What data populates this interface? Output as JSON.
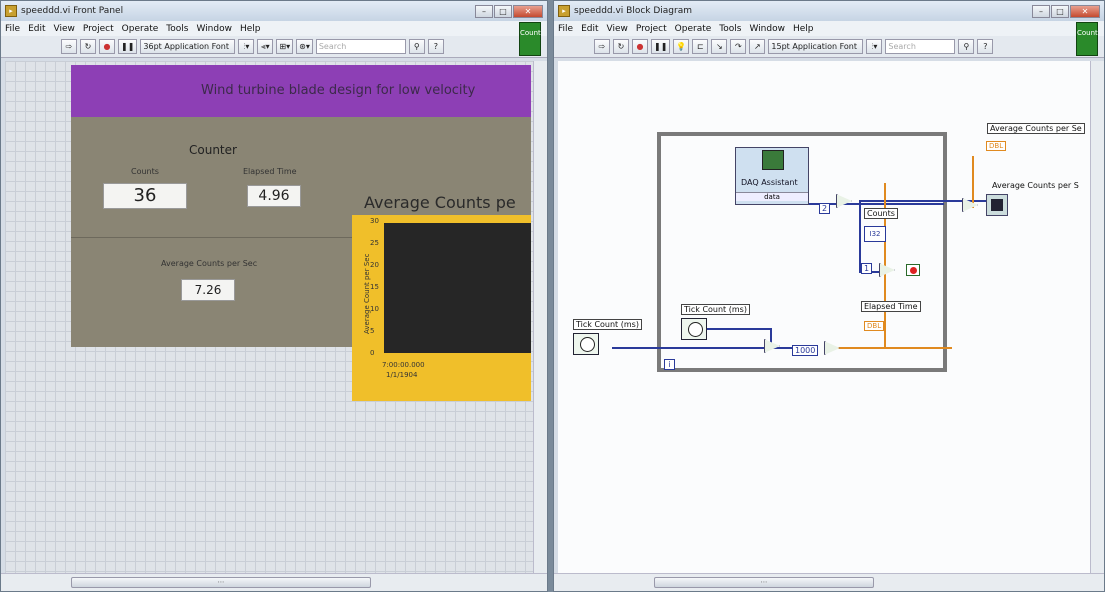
{
  "left_window": {
    "title": "speeddd.vi Front Panel",
    "menu": [
      "File",
      "Edit",
      "View",
      "Project",
      "Operate",
      "Tools",
      "Window",
      "Help"
    ],
    "font_selector": "36pt Application Font",
    "search_placeholder": "Search",
    "count_badge": "Count",
    "panel": {
      "banner": "Wind turbine blade design for low velocity",
      "counter_title": "Counter",
      "counts_label": "Counts",
      "counts_value": "36",
      "elapsed_label": "Elapsed Time",
      "elapsed_value": "4.96",
      "avg_label": "Average Counts per Sec",
      "avg_value": "7.26",
      "chart_title": "Average Counts pe",
      "chart_ylabel": "Average Count per Sec",
      "chart_yticks": [
        "30",
        "25",
        "20",
        "15",
        "10",
        "5",
        "0"
      ],
      "chart_xlabel_time": "7:00:00.000",
      "chart_xlabel_date": "1/1/1904"
    }
  },
  "right_window": {
    "title": "speeddd.vi Block Diagram",
    "menu": [
      "File",
      "Edit",
      "View",
      "Project",
      "Operate",
      "Tools",
      "Window",
      "Help"
    ],
    "font_selector": "15pt Application Font",
    "search_placeholder": "Search",
    "count_badge": "Count",
    "diagram": {
      "daq_title": "DAQ Assistant",
      "daq_output": "data",
      "const_2": "2",
      "counts_label": "Counts",
      "i32": "I32",
      "const_1": "1",
      "tick1_label": "Tick Count (ms)",
      "tick2_label": "Tick Count (ms)",
      "const_1000": "1000",
      "elapsed_label": "Elapsed Time",
      "avg_label1": "Average Counts per Se",
      "avg_label2": "Average Counts per S",
      "dbl": "DBL",
      "loop_index": "i"
    }
  },
  "colors": {
    "banner": "#8d3fb5",
    "panel_bg": "#8a8574",
    "chart_frame": "#f0bf2a",
    "wire_blue": "#2a3a9a",
    "wire_orange": "#e08a20"
  }
}
